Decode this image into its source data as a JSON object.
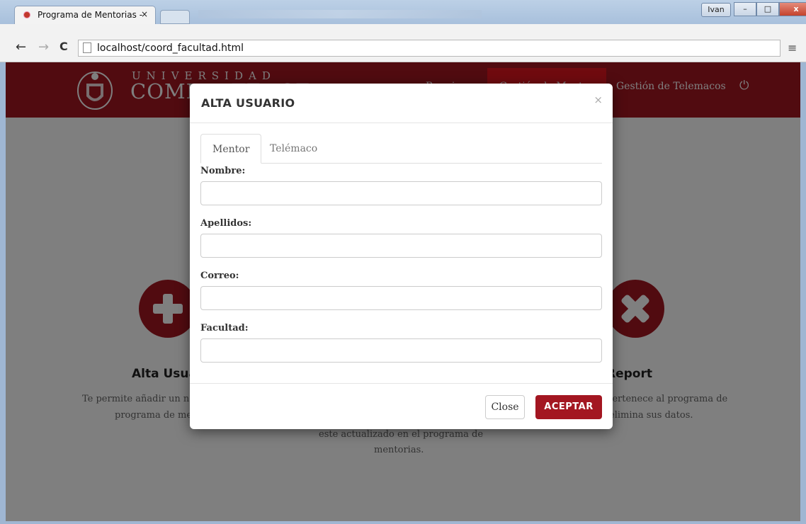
{
  "browser": {
    "tab_title": "Programa de Mentorias - ",
    "tab_close": "×",
    "url_host": "localhost/coord_facultad.html",
    "user_badge": "Ivan",
    "back_glyph": "←",
    "forward_glyph": "→",
    "reload_glyph": "C",
    "menu_glyph": "≡",
    "min_glyph": "–",
    "max_glyph": "□",
    "close_glyph": "x"
  },
  "header": {
    "brand_top": "UNIVERSIDAD",
    "brand_bottom": "COMPLUTENSE",
    "nav_items": [
      "Reunion",
      "Gestión de Mentores",
      "Gestión de Telemacos"
    ],
    "power_icon": "power-icon",
    "accent": "#a31621",
    "active_accent": "#e0141e"
  },
  "background_content": {
    "card_left": {
      "title": "Alta Usua",
      "line1": "Te permite añadir un n",
      "line2": "programa de me",
      "icon": "plus-icon"
    },
    "card_middle": {
      "line1": "este actualizado en el programa de",
      "line2": "mentorias."
    },
    "card_right": {
      "title": "Report",
      "line1": "pertenece al programa de",
      "line2": "elimina sus datos.",
      "icon": "close-icon"
    }
  },
  "modal": {
    "title": "ALTA USUARIO",
    "close_glyph": "×",
    "tabs": [
      {
        "label": "Mentor",
        "active": true
      },
      {
        "label": "Telémaco",
        "active": false
      }
    ],
    "fields": [
      {
        "label": "Nombre:",
        "value": ""
      },
      {
        "label": "Apellidos:",
        "value": ""
      },
      {
        "label": "Correo:",
        "value": ""
      },
      {
        "label": "Facultad:",
        "value": ""
      }
    ],
    "close_button": "Close",
    "accept_button": "ACEPTAR"
  }
}
